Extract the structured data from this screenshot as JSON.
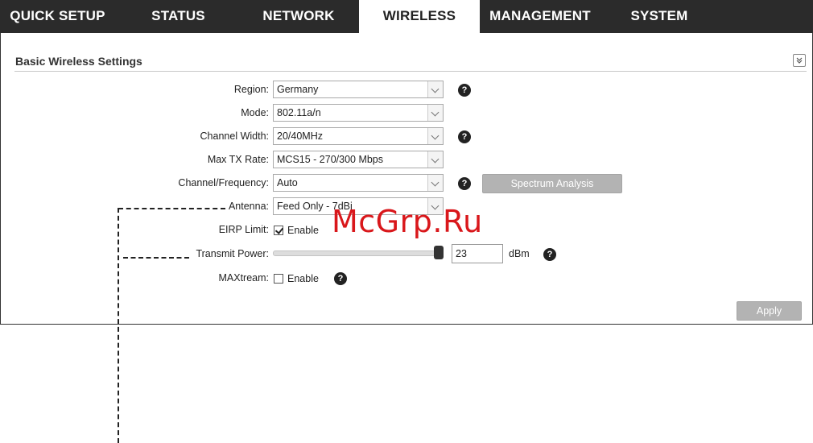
{
  "nav": {
    "tabs": [
      {
        "label": "QUICK SETUP"
      },
      {
        "label": "STATUS"
      },
      {
        "label": "NETWORK"
      },
      {
        "label": "WIRELESS"
      },
      {
        "label": "MANAGEMENT"
      },
      {
        "label": "SYSTEM"
      }
    ],
    "active": "WIRELESS"
  },
  "section": {
    "title": "Basic Wireless Settings",
    "collapse_icon": "double-chevron-down-icon"
  },
  "form": {
    "region": {
      "label": "Region:",
      "value": "Germany"
    },
    "mode": {
      "label": "Mode:",
      "value": "802.11a/n"
    },
    "channel_width": {
      "label": "Channel Width:",
      "value": "20/40MHz"
    },
    "max_tx_rate": {
      "label": "Max TX Rate:",
      "value": "MCS15 - 270/300 Mbps"
    },
    "channel_frequency": {
      "label": "Channel/Frequency:",
      "value": "Auto",
      "button": "Spectrum Analysis"
    },
    "antenna": {
      "label": "Antenna:",
      "value": "Feed Only - 7dBi"
    },
    "eirp_limit": {
      "label": "EIRP Limit:",
      "checkbox_label": "Enable",
      "checked": true
    },
    "transmit_power": {
      "label": "Transmit Power:",
      "value": "23",
      "unit": "dBm",
      "slider_level": 1.0
    },
    "maxtream": {
      "label": "MAXtream:",
      "checkbox_label": "Enable",
      "checked": false
    }
  },
  "help_glyph": "?",
  "apply_label": "Apply",
  "watermark": "McGrp.Ru",
  "colors": {
    "nav_bg": "#2b2b2b",
    "button_gray": "#b3b3b3",
    "watermark": "#d9171b"
  }
}
